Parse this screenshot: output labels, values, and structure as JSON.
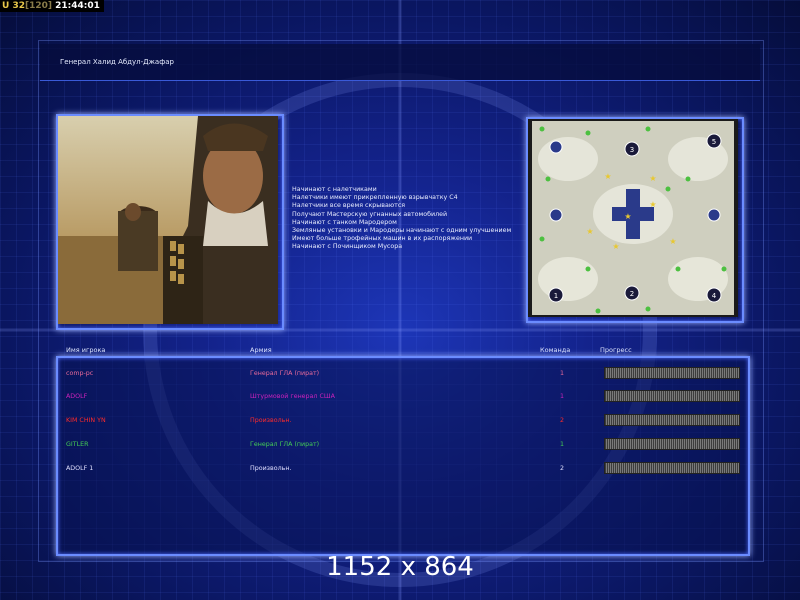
{
  "status_bar": {
    "prefix": "U",
    "value": "32",
    "bracket": "[120]",
    "time": "21:44:01"
  },
  "general": {
    "title": "Генерал Халид Абдул-Джафар",
    "description": [
      "Начинают с налетчиками",
      "Налетчики имеют прикрепленную взрывчатку C4",
      "Налетчики все время скрываются",
      "Получают Мастерскую угнанных автомобилей",
      "Начинают с танком Мародером",
      "Земляные установки и Мародеры начинают с одним улучшением",
      "Имеют больше трофейных машин в их распоряжении",
      "Начинают с Починщиком Мусора"
    ]
  },
  "map": {
    "start_positions": [
      "1",
      "2",
      "3",
      "4",
      "5"
    ]
  },
  "table": {
    "headers": {
      "player": "Имя игрока",
      "army": "Армия",
      "team": "Команда",
      "progress": "Прогресс"
    },
    "rows": [
      {
        "player": "comp-pc",
        "army": "Генерал ГЛА (пират)",
        "team": "1",
        "color": "#e86a9a",
        "progress": 1.0
      },
      {
        "player": "ADOLF",
        "army": "Штурмовой генерал США",
        "team": "1",
        "color": "#cc22bb",
        "progress": 1.0
      },
      {
        "player": "KIM CHIN YN",
        "army": "Произвольн.",
        "team": "2",
        "color": "#ff2b2b",
        "progress": 1.0
      },
      {
        "player": "GITLER",
        "army": "Генерал ГЛА (пират)",
        "team": "1",
        "color": "#44cc55",
        "progress": 1.0
      },
      {
        "player": "ADOLF 1",
        "army": "Произвольн.",
        "team": "2",
        "color": "#e0e0ff",
        "progress": 1.0
      }
    ]
  },
  "resolution_label": "1152 x 864",
  "colors": {
    "frame_glow": "#6b8cff",
    "background": "#13228a"
  }
}
